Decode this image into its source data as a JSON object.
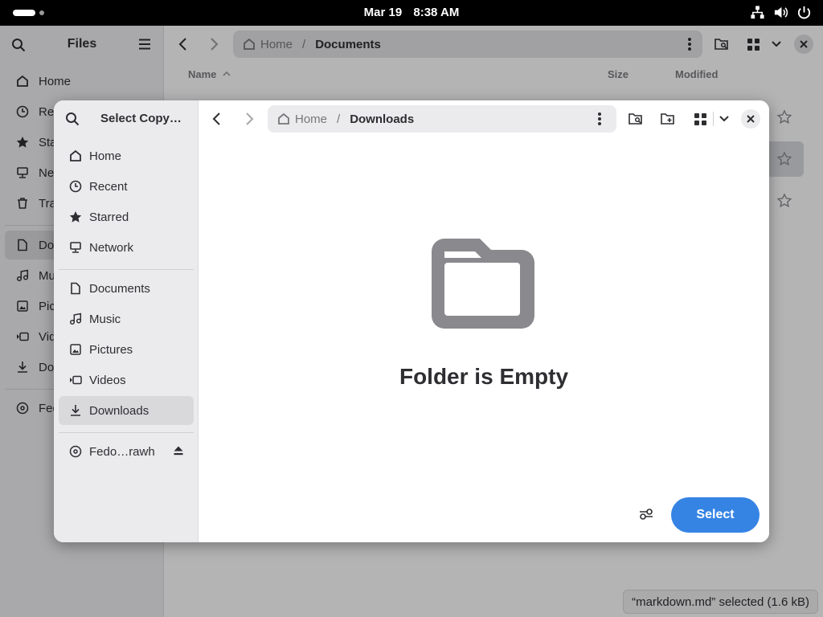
{
  "topbar": {
    "date": "Mar 19",
    "time": "8:38 AM"
  },
  "background_window": {
    "sidebar_title": "Files",
    "sidebar_items": [
      {
        "label": "Home",
        "icon": "home-icon"
      },
      {
        "label": "Rec",
        "icon": "clock-icon"
      },
      {
        "label": "Sta",
        "icon": "star-icon"
      },
      {
        "label": "Net",
        "icon": "network-icon"
      },
      {
        "label": "Tra",
        "icon": "trash-icon"
      },
      {
        "label": "Doc",
        "icon": "document-icon"
      },
      {
        "label": "Mu",
        "icon": "music-icon"
      },
      {
        "label": "Pict",
        "icon": "picture-icon"
      },
      {
        "label": "Vid",
        "icon": "video-icon"
      },
      {
        "label": "Dov",
        "icon": "download-icon"
      },
      {
        "label": "Fed",
        "icon": "disk-icon"
      }
    ],
    "path": {
      "home": "Home",
      "separator": "/",
      "current": "Documents"
    },
    "columns": {
      "name": "Name",
      "size": "Size",
      "modified": "Modified"
    },
    "status": "“markdown.md” selected  (1.6 kB)"
  },
  "dialog": {
    "title": "Select Copy…",
    "places": [
      {
        "label": "Home",
        "icon": "home-icon"
      },
      {
        "label": "Recent",
        "icon": "clock-icon"
      },
      {
        "label": "Starred",
        "icon": "star-icon"
      },
      {
        "label": "Network",
        "icon": "network-icon"
      }
    ],
    "bookmarks": [
      {
        "label": "Documents",
        "icon": "document-icon"
      },
      {
        "label": "Music",
        "icon": "music-icon"
      },
      {
        "label": "Pictures",
        "icon": "picture-icon"
      },
      {
        "label": "Videos",
        "icon": "video-icon"
      },
      {
        "label": "Downloads",
        "icon": "download-icon",
        "active": true
      }
    ],
    "devices": [
      {
        "label": "Fedo…rawh",
        "icon": "disk-icon"
      }
    ],
    "path": {
      "home": "Home",
      "separator": "/",
      "current": "Downloads"
    },
    "empty_message": "Folder is Empty",
    "select_label": "Select"
  },
  "colors": {
    "accent": "#3584e4",
    "sidebar_bg": "#ebebed",
    "topbar_bg": "#000000"
  }
}
